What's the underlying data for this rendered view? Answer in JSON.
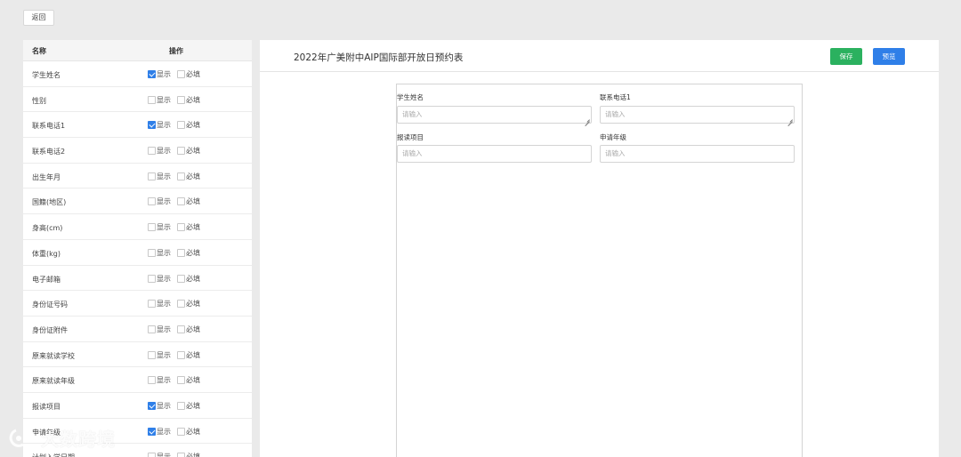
{
  "toolbar": {
    "back_label": "返回"
  },
  "field_list": {
    "header_name": "名称",
    "header_op": "操作",
    "show_label": "显示",
    "required_label": "必填",
    "items": [
      {
        "name": "学生姓名",
        "show": true,
        "required": false
      },
      {
        "name": "性别",
        "show": false,
        "required": false
      },
      {
        "name": "联系电话1",
        "show": true,
        "required": false
      },
      {
        "name": "联系电话2",
        "show": false,
        "required": false
      },
      {
        "name": "出生年月",
        "show": false,
        "required": false
      },
      {
        "name": "国籍(地区)",
        "show": false,
        "required": false
      },
      {
        "name": "身高(cm)",
        "show": false,
        "required": false
      },
      {
        "name": "体重(kg)",
        "show": false,
        "required": false
      },
      {
        "name": "电子邮箱",
        "show": false,
        "required": false
      },
      {
        "name": "身份证号码",
        "show": false,
        "required": false
      },
      {
        "name": "身份证附件",
        "show": false,
        "required": false
      },
      {
        "name": "原来就读学校",
        "show": false,
        "required": false
      },
      {
        "name": "原来就读年级",
        "show": false,
        "required": false
      },
      {
        "name": "报读项目",
        "show": true,
        "required": false
      },
      {
        "name": "申请年级",
        "show": true,
        "required": false
      },
      {
        "name": "计划入学日期",
        "show": false,
        "required": false
      }
    ]
  },
  "editor": {
    "title": "2022年广美附中AIP国际部开放日预约表",
    "save_label": "保存",
    "preview_label": "预览",
    "fields": [
      {
        "label": "学生姓名",
        "placeholder": "请输入",
        "type": "textarea"
      },
      {
        "label": "联系电话1",
        "placeholder": "请输入",
        "type": "textarea"
      },
      {
        "label": "报读项目",
        "placeholder": "请输入",
        "type": "input"
      },
      {
        "label": "申请年级",
        "placeholder": "请输入",
        "type": "input"
      }
    ]
  },
  "watermark": {
    "text": "大数跨境"
  },
  "colors": {
    "save": "#2bb15f",
    "preview": "#2f7fe8",
    "checkbox_checked": "#2f7fe8"
  }
}
